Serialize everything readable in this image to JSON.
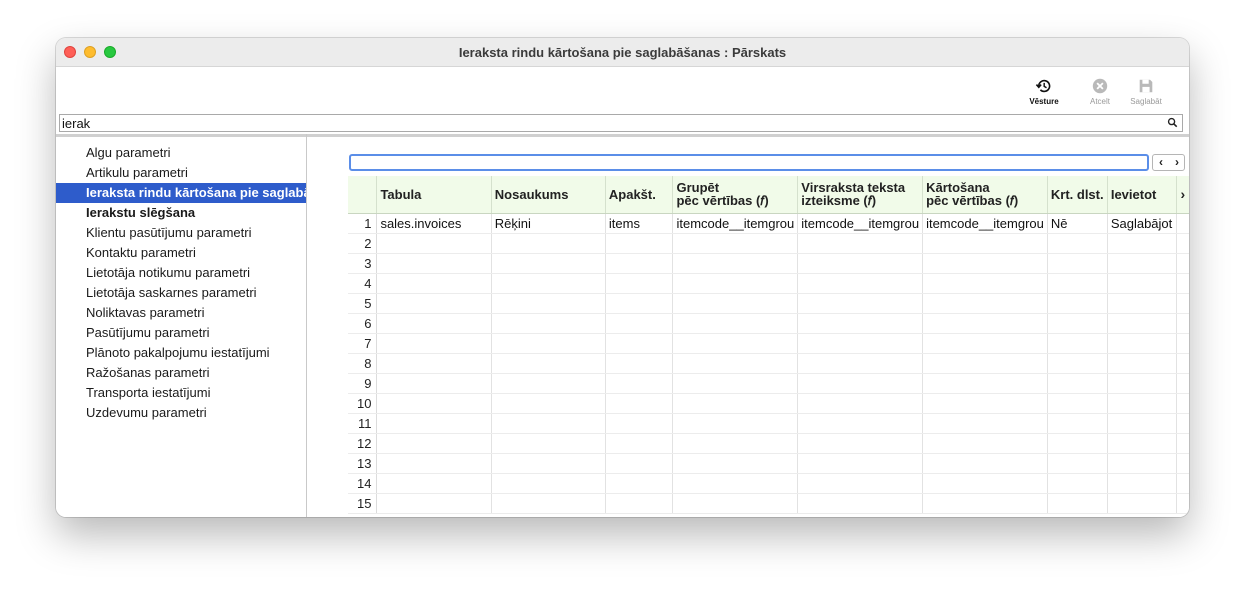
{
  "window": {
    "title": "Ieraksta rindu kārtošana pie saglabāšanas : Pārskats"
  },
  "toolbar": {
    "history_label": "Vēsture",
    "cancel_label": "Atcelt",
    "save_label": "Saglabāt"
  },
  "search": {
    "value": "ierak"
  },
  "sidebar": {
    "items": [
      {
        "label": "Algu parametri"
      },
      {
        "label": "Artikulu parametri"
      },
      {
        "label": "Ieraksta rindu kārtošana pie saglabāšanas"
      },
      {
        "label": "Ierakstu slēgšana"
      },
      {
        "label": "Klientu pasūtījumu parametri"
      },
      {
        "label": "Kontaktu parametri"
      },
      {
        "label": "Lietotāja notikumu parametri"
      },
      {
        "label": "Lietotāja saskarnes parametri"
      },
      {
        "label": "Noliktavas parametri"
      },
      {
        "label": "Pasūtījumu parametri"
      },
      {
        "label": "Plānoto pakalpojumu iestatījumi"
      },
      {
        "label": "Ražošanas parametri"
      },
      {
        "label": "Transporta iestatījumi"
      },
      {
        "label": "Uzdevumu parametri"
      }
    ]
  },
  "filter": {
    "value": ""
  },
  "nav": {
    "prev": "‹",
    "next": "›"
  },
  "table": {
    "columns": [
      {
        "line1": "Tabula",
        "line2": ""
      },
      {
        "line1": "Nosaukums",
        "line2": ""
      },
      {
        "line1": "Apakšt.",
        "line2": ""
      },
      {
        "line1": "Grupēt",
        "line2": "pēc vērtības (𝑓)"
      },
      {
        "line1": "Virsraksta teksta",
        "line2": "izteiksme (𝑓)"
      },
      {
        "line1": "Kārtošana",
        "line2": "pēc vērtības (𝑓)"
      },
      {
        "line1": "Krt. dlst.",
        "line2": ""
      },
      {
        "line1": "Ievietot",
        "line2": ""
      }
    ],
    "more": "›",
    "row_numbers": [
      "1",
      "2",
      "3",
      "4",
      "5",
      "6",
      "7",
      "8",
      "9",
      "10",
      "11",
      "12",
      "13",
      "14",
      "15"
    ],
    "rows": [
      [
        "sales.invoices",
        "Rēķini",
        "items",
        "itemcode__itemgrou",
        "itemcode__itemgrou",
        "itemcode__itemgrou",
        "Nē",
        "Saglabājot"
      ]
    ]
  }
}
